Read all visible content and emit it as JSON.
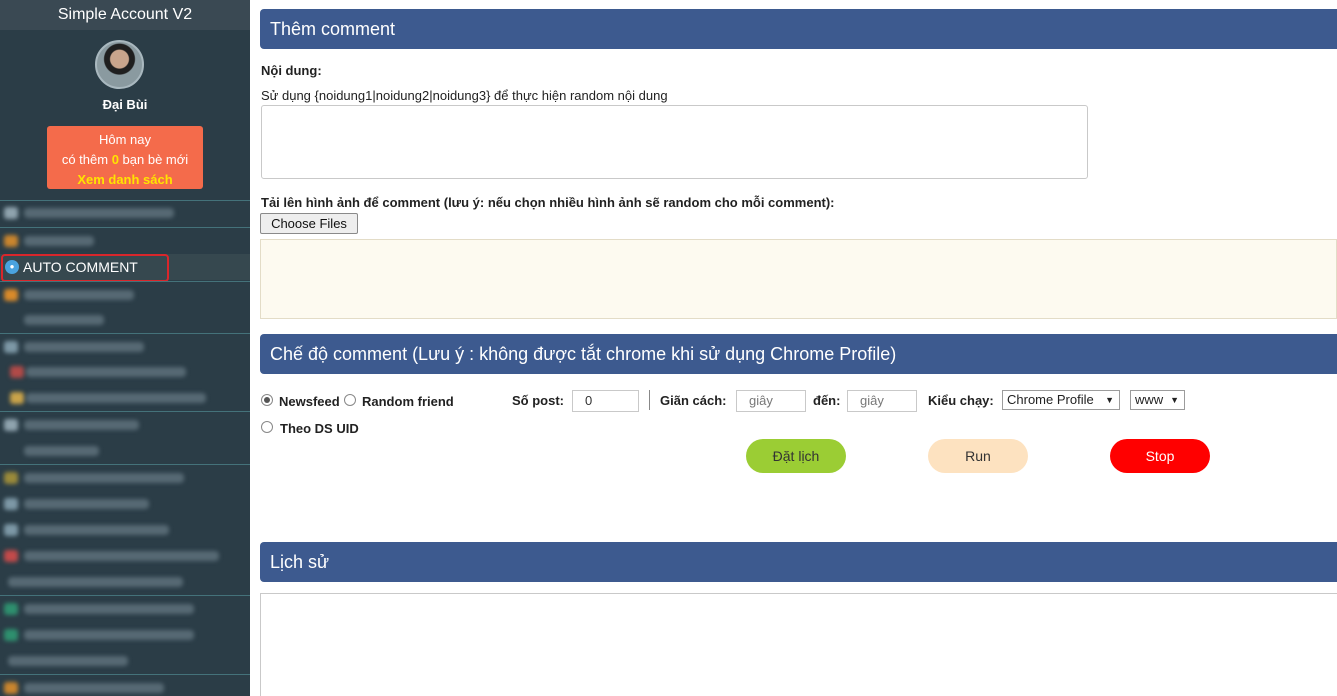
{
  "sidebar": {
    "app_title": "Simple Account V2",
    "username": "Đại Bùi",
    "notice": {
      "line1": "Hôm nay",
      "line2_prefix": "có thêm ",
      "count": "0",
      "line2_suffix": " bạn bè mới",
      "link": "Xem danh sách"
    },
    "active_item": "AUTO COMMENT"
  },
  "comment_panel": {
    "title": "Thêm comment",
    "content_label": "Nội dung:",
    "content_hint": "Sử dụng {noidung1|noidung2|noidung3} để thực hiện random nội dung",
    "content_value": "",
    "upload_label": "Tải lên hình ảnh để comment (lưu ý: nếu chọn nhiều hình ảnh sẽ random cho mỗi comment):",
    "choose_files": "Choose Files"
  },
  "mode_panel": {
    "title": "Chế độ comment (Lưu ý : không được tắt chrome khi sử dụng Chrome Profile)",
    "options": {
      "newsfeed": "Newsfeed",
      "random_friend": "Random friend",
      "by_uid": "Theo DS UID"
    },
    "selected_option": "Newsfeed",
    "post_count_label": "Số post:",
    "post_count_value": "0",
    "interval_label": "Giãn cách:",
    "interval_from_placeholder": "giây",
    "to_label": "đến:",
    "interval_to_placeholder": "giây",
    "run_mode_label": "Kiểu chạy:",
    "run_mode_value": "Chrome Profile",
    "domain_value": "www",
    "buttons": {
      "schedule": "Đặt lịch",
      "run": "Run",
      "stop": "Stop"
    }
  },
  "history_panel": {
    "title": "Lịch sử",
    "content": ""
  }
}
